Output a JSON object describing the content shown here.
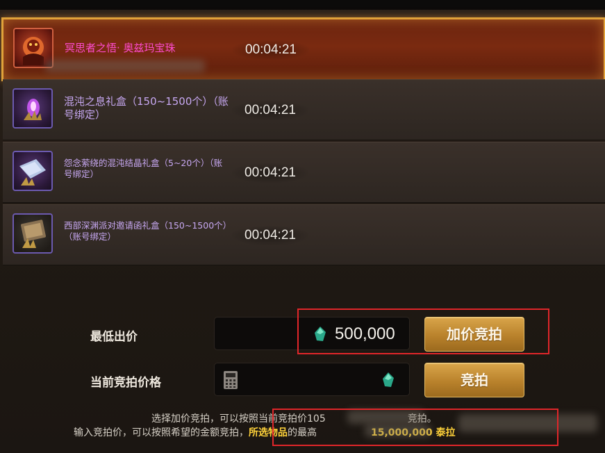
{
  "auction_list": [
    {
      "name": "冥思者之悟· 奥兹玛宝珠",
      "timer": "00:04:21",
      "icon": "demon-orb-icon",
      "selected": true
    },
    {
      "name": "混沌之息礼盒（150~1500个）（账号绑定）",
      "timer": "00:04:21",
      "icon": "purple-crystal-icon",
      "selected": false
    },
    {
      "name": "怨念萦绕的混沌结晶礼盒（5~20个）（账号绑定）",
      "timer": "00:04:21",
      "icon": "crystal-box-icon",
      "selected": false
    },
    {
      "name": "西部深渊派对邀请函礼盒（150~1500个）（账号绑定）",
      "timer": "00:04:21",
      "icon": "invitation-box-icon",
      "selected": false
    }
  ],
  "bid_panel": {
    "min_bid_label": "最低出价",
    "min_bid_amount": "500,000",
    "raise_bid_button": "加价竞拍",
    "current_price_label": "当前竞拍价格",
    "current_price_amount": "",
    "bid_button": "竞拍",
    "currency_icon": "green-gem-icon",
    "calculator_icon": "calculator-icon"
  },
  "hints": {
    "line1": "选择加价竞拍，可以按照当前竞拍价105",
    "line1_end": "竞拍。",
    "line2_start": "输入竞拍价，可以按照希望的金额竞拍，",
    "line2_highlight": "所选物品",
    "line2_mid": "的最高",
    "line2_amount": "15,000,000 泰拉"
  },
  "colors": {
    "accent_gold": "#d9a54a",
    "selected_name": "#ff4bd0",
    "item_name": "#c7a8f2",
    "annotation_red": "#e0262a",
    "highlight_yellow": "#ffd23a"
  }
}
